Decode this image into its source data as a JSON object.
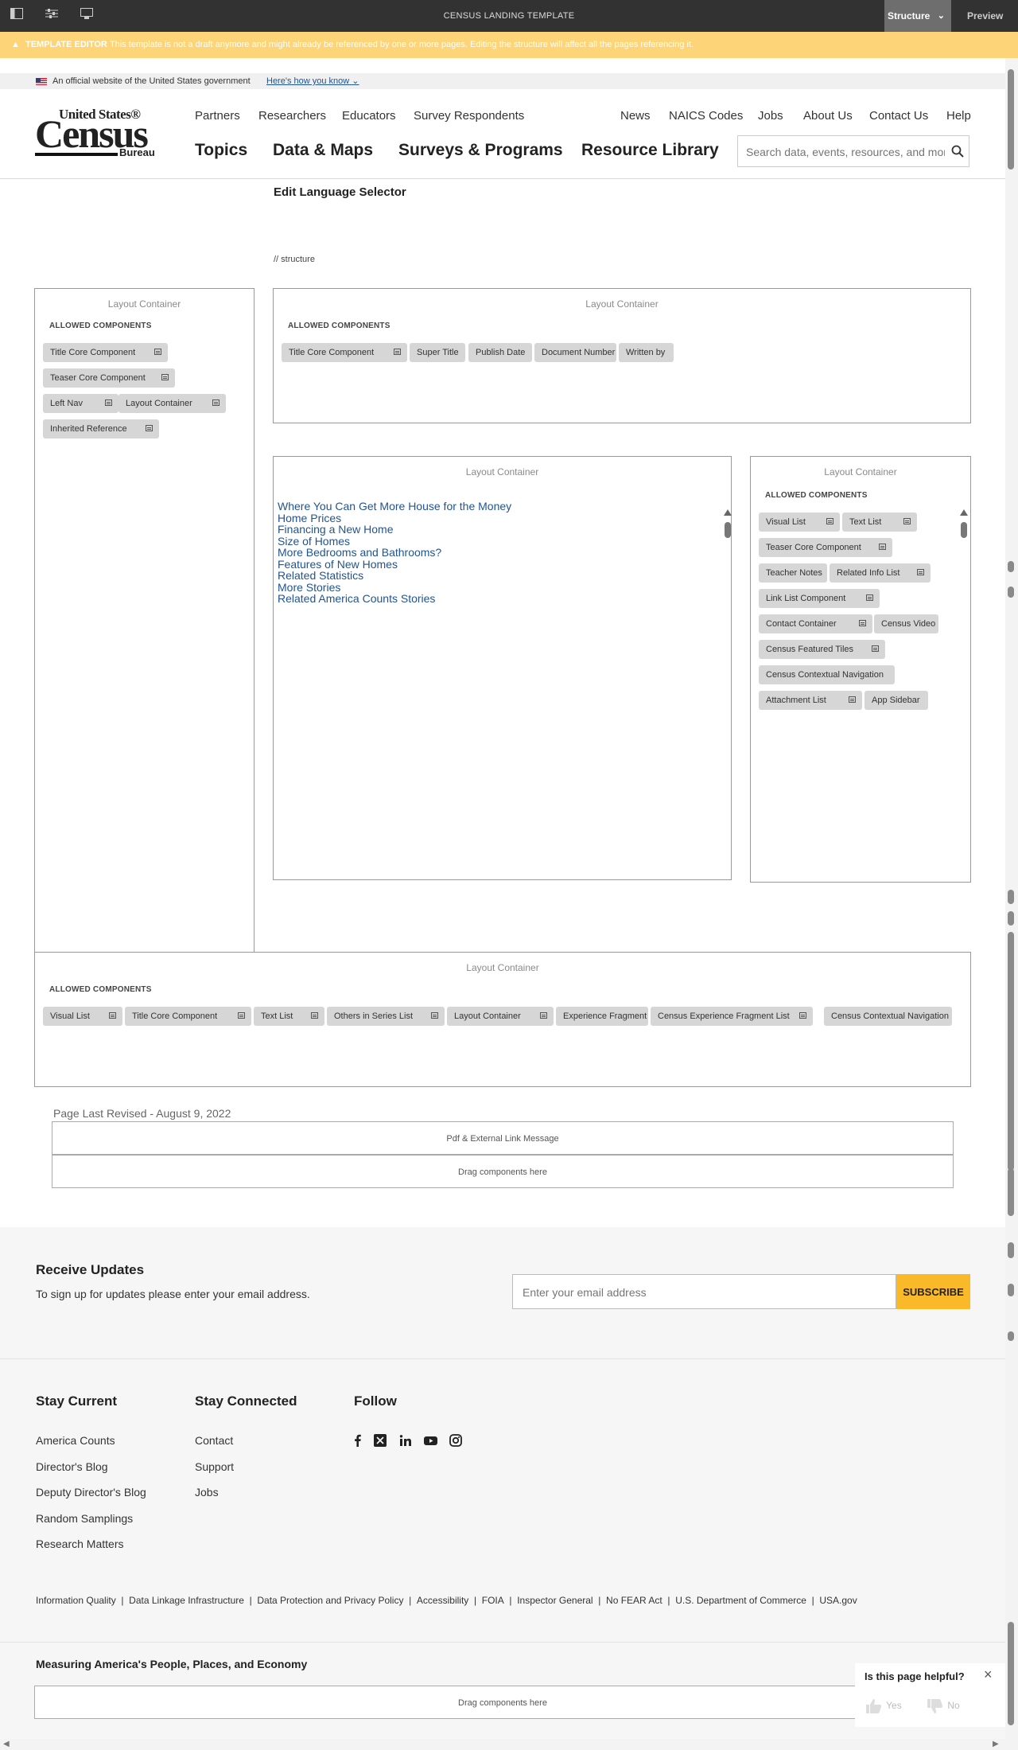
{
  "editor": {
    "title": "CENSUS LANDING TEMPLATE",
    "mode_label": "Structure",
    "preview_label": "Preview",
    "warning_label": "TEMPLATE EDITOR",
    "warning_text": "This template is not a draft anymore and might already be referenced by one or more pages. Editing the structure will affect all the pages referencing it."
  },
  "gov_banner": {
    "text": "An official website of the United States government",
    "link": "Here's how you know"
  },
  "logo": {
    "line1": "United States®",
    "line2": "Census",
    "line3": "Bureau"
  },
  "nav_top": [
    "Partners",
    "Researchers",
    "Educators",
    "Survey Respondents",
    "News",
    "NAICS Codes",
    "Jobs",
    "About Us",
    "Contact Us",
    "Help"
  ],
  "nav_main": [
    "Topics",
    "Data & Maps",
    "Surveys & Programs",
    "Resource Library"
  ],
  "search": {
    "placeholder": "Search data, events, resources, and more"
  },
  "lang_selector": "Edit Language Selector",
  "structure_path": "//  structure",
  "containers": {
    "title": "Layout Container",
    "allowed": "ALLOWED COMPONENTS",
    "left": [
      "Title Core Component",
      "Teaser Core Component",
      "Left Nav",
      "Layout Container",
      "Inherited Reference"
    ],
    "top": [
      "Title Core Component",
      "Super Title",
      "Publish Date",
      "Document Number",
      "Written by"
    ],
    "right": [
      "Visual List",
      "Text List",
      "Teaser Core Component",
      "Teacher Notes",
      "Related Info List",
      "Link List Component",
      "Contact Container",
      "Census Video",
      "Census Featured Tiles",
      "Census Contextual Navigation",
      "Attachment List",
      "App Sidebar"
    ],
    "bottom": [
      "Visual List",
      "Title Core Component",
      "Text List",
      "Others in Series List",
      "Layout Container",
      "Experience Fragment",
      "Census Experience Fragment List",
      "Census Contextual Navigation"
    ]
  },
  "toc_links": [
    "Where You Can Get More House for the Money",
    "Home Prices",
    "Financing a New Home",
    "Size of Homes",
    "More Bedrooms and Bathrooms?",
    "Features of New Homes",
    "Related Statistics",
    "More Stories",
    "Related America Counts Stories"
  ],
  "page_revised": "Page Last Revised - August 9, 2022",
  "dropzones": {
    "pdf": "Pdf & External Link Message",
    "drag": "Drag components here"
  },
  "updates": {
    "title": "Receive Updates",
    "desc": "To sign up for updates please enter your email address.",
    "placeholder": "Enter your email address",
    "button": "SUBSCRIBE"
  },
  "footer": {
    "stay_current_title": "Stay Current",
    "stay_current": [
      "America Counts",
      "Director's Blog",
      "Deputy Director's Blog",
      "Random Samplings",
      "Research Matters"
    ],
    "stay_connected_title": "Stay Connected",
    "stay_connected": [
      "Contact",
      "Support",
      "Jobs"
    ],
    "follow_title": "Follow",
    "social_icons": [
      "facebook-icon",
      "x-icon",
      "linkedin-icon",
      "youtube-icon",
      "instagram-icon"
    ],
    "legal": [
      "Information Quality",
      "Data Linkage Infrastructure",
      "Data Protection and Privacy Policy",
      "Accessibility",
      "FOIA",
      "Inspector General",
      "No FEAR Act",
      "U.S. Department of Commerce",
      "USA.gov"
    ],
    "tagline": "Measuring America's People, Places, and Economy"
  },
  "feedback": {
    "question": "Is this page helpful?",
    "yes": "Yes",
    "no": "No"
  },
  "colors": {
    "editor_bar": "#323232",
    "warning": "#fdd477",
    "link": "#205493",
    "subscribe": "#f9b928"
  }
}
